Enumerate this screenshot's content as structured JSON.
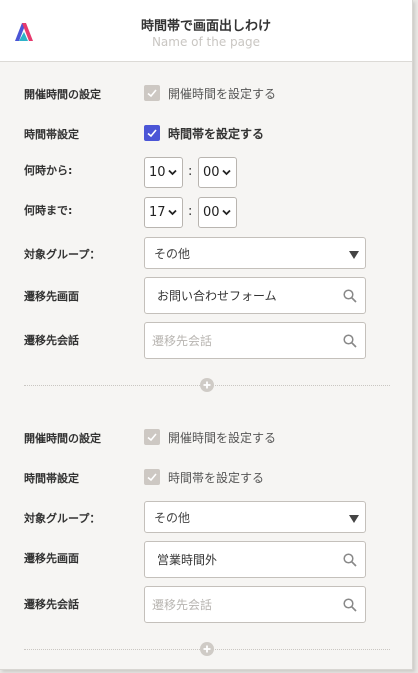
{
  "header": {
    "title": "時間帯で画面出しわけ",
    "subtitle": "Name of the page"
  },
  "sections": [
    {
      "hours_label": "開催時間の設定",
      "hours_checkbox_text": "開催時間を設定する",
      "hours_checked": false,
      "timeslot_label": "時間帯設定",
      "timeslot_checkbox_text": "時間帯を設定する",
      "timeslot_checked": true,
      "from_label": "何時から:",
      "from_hour": "10",
      "from_minute": "00",
      "to_label": "何時まで:",
      "to_hour": "17",
      "to_minute": "00",
      "time_separator": ":",
      "group_label": "対象グループ：",
      "group_value": "その他",
      "screen_label": "遷移先画面",
      "screen_value": "お問い合わせフォーム",
      "talk_label": "遷移先会話",
      "talk_placeholder": "遷移先会話"
    },
    {
      "hours_label": "開催時間の設定",
      "hours_checkbox_text": "開催時間を設定する",
      "hours_checked": false,
      "timeslot_label": "時間帯設定",
      "timeslot_checkbox_text": "時間帯を設定する",
      "timeslot_checked": false,
      "group_label": "対象グループ：",
      "group_value": "その他",
      "screen_label": "遷移先画面",
      "screen_value": "営業時間外",
      "talk_label": "遷移先会話",
      "talk_placeholder": "遷移先会話"
    }
  ],
  "colors": {
    "accent": "#4b55d6",
    "checkbox_off": "#cdc8c3",
    "background": "#f6f5f3"
  },
  "icons": [
    "app-logo-icon",
    "checkmark-icon",
    "chevron-down-icon",
    "caret-down-icon",
    "search-icon",
    "plus-icon"
  ]
}
